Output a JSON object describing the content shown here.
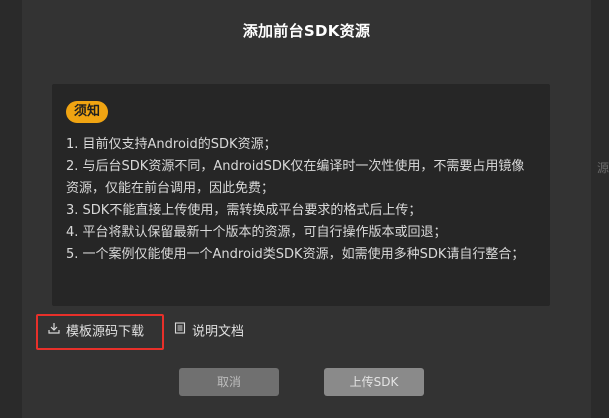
{
  "dialog": {
    "title": "添加前台SDK资源"
  },
  "notice": {
    "tag": "须知",
    "items": [
      "1. 目前仅支持Android的SDK资源；",
      "2. 与后台SDK资源不同，AndroidSDK仅在编译时一次性使用，不需要占用镜像资源，仅能在前台调用，因此免费；",
      "3. SDK不能直接上传使用，需转换成平台要求的格式后上传；",
      "4. 平台将默认保留最新十个版本的资源，可自行操作版本或回退；",
      "5. 一个案例仅能使用一个Android类SDK资源，如需使用多种SDK请自行整合；"
    ]
  },
  "links": {
    "download": {
      "label": "模板源码下载",
      "icon": "download-icon"
    },
    "docs": {
      "label": "说明文档",
      "icon": "document-icon"
    }
  },
  "buttons": {
    "cancel": "取消",
    "upload": "上传SDK"
  },
  "edge_glyph": "源",
  "colors": {
    "notice_tag": "#f0a412",
    "highlight_border": "#e8302a",
    "dialog_bg": "#333333",
    "notice_bg": "#262626"
  }
}
